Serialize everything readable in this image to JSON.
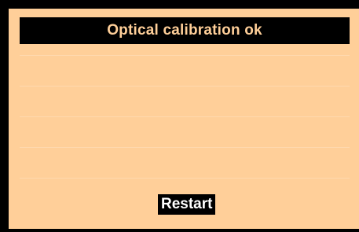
{
  "screen": {
    "title": "Optical calibration ok",
    "restart_label": "Restart"
  },
  "colors": {
    "screen_background": "#ffcf99",
    "bezel": "#000000",
    "title_text": "#ffcf99",
    "button_text": "#ffffff"
  }
}
